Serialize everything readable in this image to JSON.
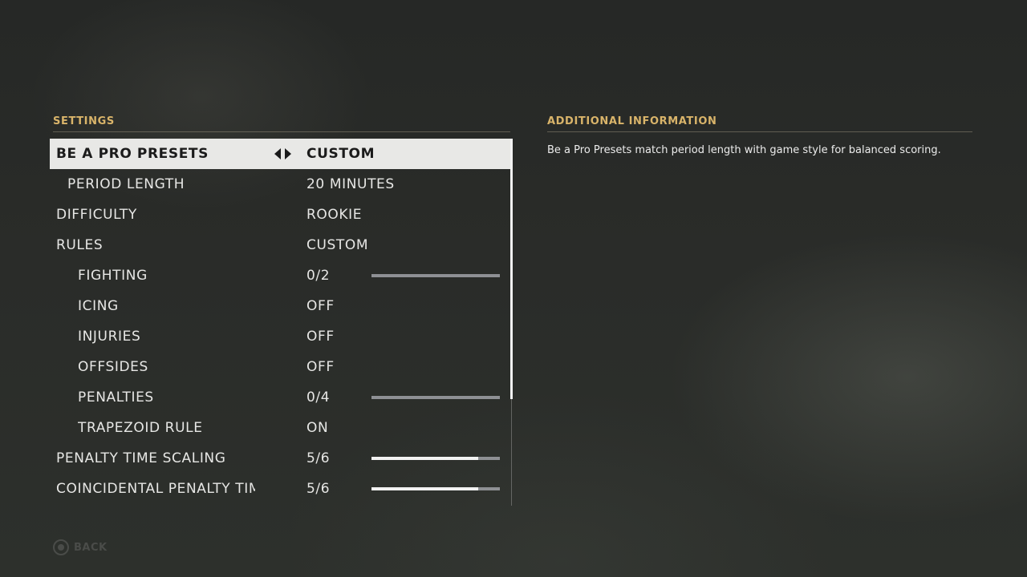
{
  "settings_header": "SETTINGS",
  "info_header": "ADDITIONAL INFORMATION",
  "info_text": "Be a Pro Presets match period length with game style for balanced scoring.",
  "rows": [
    {
      "label": "BE A PRO PRESETS",
      "value": "CUSTOM"
    },
    {
      "label": "PERIOD LENGTH",
      "value": "20 MINUTES"
    },
    {
      "label": "DIFFICULTY",
      "value": "ROOKIE"
    },
    {
      "label": "RULES",
      "value": "CUSTOM"
    },
    {
      "label": "FIGHTING",
      "value": "0/2",
      "slider_fraction": 0
    },
    {
      "label": "ICING",
      "value": "OFF"
    },
    {
      "label": "INJURIES",
      "value": "OFF"
    },
    {
      "label": "OFFSIDES",
      "value": "OFF"
    },
    {
      "label": "PENALTIES",
      "value": "0/4",
      "slider_fraction": 0
    },
    {
      "label": "TRAPEZOID RULE",
      "value": "ON"
    },
    {
      "label": "PENALTY TIME SCALING",
      "value": "5/6",
      "slider_fraction": 0.8333
    },
    {
      "label": "COINCIDENTAL PENALTY TIME",
      "value": "5/6",
      "slider_fraction": 0.8333
    }
  ],
  "back_label": "BACK",
  "colors": {
    "accent": "#d9b46a",
    "selected_bg": "#e8e8e6",
    "slider_track": "#8e9094",
    "slider_fill": "#f2f2f2"
  }
}
